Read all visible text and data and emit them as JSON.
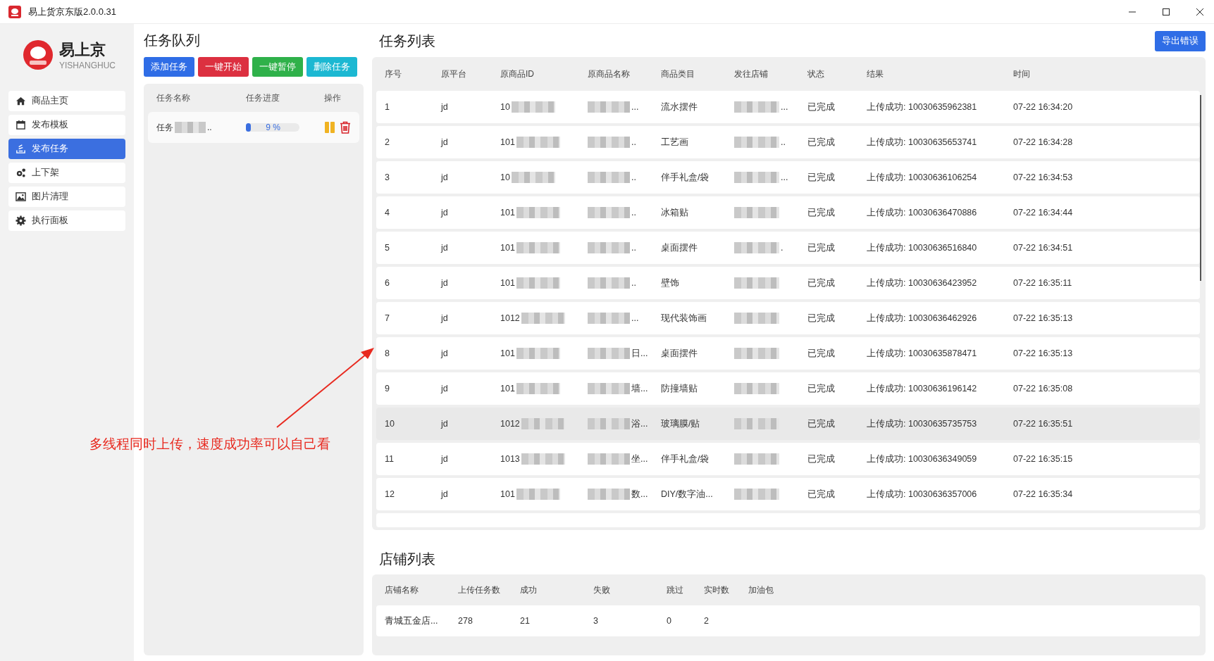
{
  "window": {
    "title": "易上货京东版2.0.0.31"
  },
  "brand": {
    "name": "易上京",
    "subtitle": "YISHANGHUC"
  },
  "sidebar": {
    "items": [
      {
        "label": "商品主页",
        "selected": false
      },
      {
        "label": "发布模板",
        "selected": false
      },
      {
        "label": "发布任务",
        "selected": true
      },
      {
        "label": "上下架",
        "selected": false
      },
      {
        "label": "图片清理",
        "selected": false
      },
      {
        "label": "执行面板",
        "selected": false
      }
    ]
  },
  "task_queue": {
    "title": "任务队列",
    "buttons": [
      {
        "label": "添加任务",
        "kind": "primary"
      },
      {
        "label": "一键开始",
        "kind": "danger"
      },
      {
        "label": "一键暂停",
        "kind": "success"
      },
      {
        "label": "删除任务",
        "kind": "info"
      }
    ],
    "columns": [
      "任务名称",
      "任务进度",
      "操作"
    ],
    "rows": [
      {
        "name": "任务",
        "name_tail": "..",
        "level": 0.09,
        "progress": "9 %"
      }
    ]
  },
  "task_list": {
    "title": "任务列表",
    "export_button": "导出错误",
    "columns": [
      "序号",
      "原平台",
      "原商品ID",
      "原商品名称",
      "商品类目",
      "发往店铺",
      "状态",
      "结果",
      "时间"
    ],
    "rows": [
      {
        "index": "1",
        "platform": "jd",
        "id": "10",
        "name": "...",
        "category": "流水摆件",
        "store": "...",
        "status": "已完成",
        "result": "上传成功: 10030635962381",
        "time": "07-22 16:34:20",
        "highlighted": false
      },
      {
        "index": "2",
        "platform": "jd",
        "id": "101",
        "name": "..",
        "category": "工艺画",
        "store": "..",
        "status": "已完成",
        "result": "上传成功: 10030635653741",
        "time": "07-22 16:34:28",
        "highlighted": false
      },
      {
        "index": "3",
        "platform": "jd",
        "id": "10",
        "name": "..",
        "category": "伴手礼盒/袋",
        "store": "...",
        "status": "已完成",
        "result": "上传成功: 10030636106254",
        "time": "07-22 16:34:53",
        "highlighted": false
      },
      {
        "index": "4",
        "platform": "jd",
        "id": "101",
        "name": "..",
        "category": "冰箱贴",
        "status": "已完成",
        "result": "上传成功: 10030636470886",
        "time": "07-22 16:34:44",
        "highlighted": false
      },
      {
        "index": "5",
        "platform": "jd",
        "id": "101",
        "name": "..",
        "category": "桌面摆件",
        "store": ".",
        "status": "已完成",
        "result": "上传成功: 10030636516840",
        "time": "07-22 16:34:51",
        "highlighted": false
      },
      {
        "index": "6",
        "platform": "jd",
        "id": "101",
        "name": "..",
        "category": "壁饰",
        "status": "已完成",
        "result": "上传成功: 10030636423952",
        "time": "07-22 16:35:11",
        "highlighted": false
      },
      {
        "index": "7",
        "platform": "jd",
        "id": "1012",
        "name": "...",
        "category": "现代装饰画",
        "status": "已完成",
        "result": "上传成功: 10030636462926",
        "time": "07-22 16:35:13",
        "highlighted": false
      },
      {
        "index": "8",
        "platform": "jd",
        "id": "101",
        "name": "日...",
        "category": "桌面摆件",
        "status": "已完成",
        "result": "上传成功: 10030635878471",
        "time": "07-22 16:35:13",
        "highlighted": false
      },
      {
        "index": "9",
        "platform": "jd",
        "id": "101",
        "name": "墙...",
        "category": "防撞墙贴",
        "status": "已完成",
        "result": "上传成功: 10030636196142",
        "time": "07-22 16:35:08",
        "highlighted": false
      },
      {
        "index": "10",
        "platform": "jd",
        "id": "1012",
        "name": "浴...",
        "category": "玻璃膜/贴",
        "status": "已完成",
        "result": "上传成功: 10030635735753",
        "time": "07-22 16:35:51",
        "highlighted": true
      },
      {
        "index": "11",
        "platform": "jd",
        "id": "1013",
        "name": "坐...",
        "category": "伴手礼盒/袋",
        "status": "已完成",
        "result": "上传成功: 10030636349059",
        "time": "07-22 16:35:15",
        "highlighted": false
      },
      {
        "index": "12",
        "platform": "jd",
        "id": "101",
        "name": "数...",
        "category": "DIY/数字油...",
        "status": "已完成",
        "result": "上传成功: 10030636357006",
        "time": "07-22 16:35:34",
        "highlighted": false
      }
    ]
  },
  "store_list": {
    "title": "店铺列表",
    "columns": [
      "店铺名称",
      "上传任务数",
      "成功",
      "失败",
      "跳过",
      "实时数",
      "加油包"
    ],
    "rows": [
      {
        "cells": [
          "青城五金店...",
          "278",
          "21",
          "3",
          "0",
          "2"
        ]
      }
    ]
  },
  "annotation": {
    "text": "多线程同时上传，速度成功率可以自己看"
  }
}
